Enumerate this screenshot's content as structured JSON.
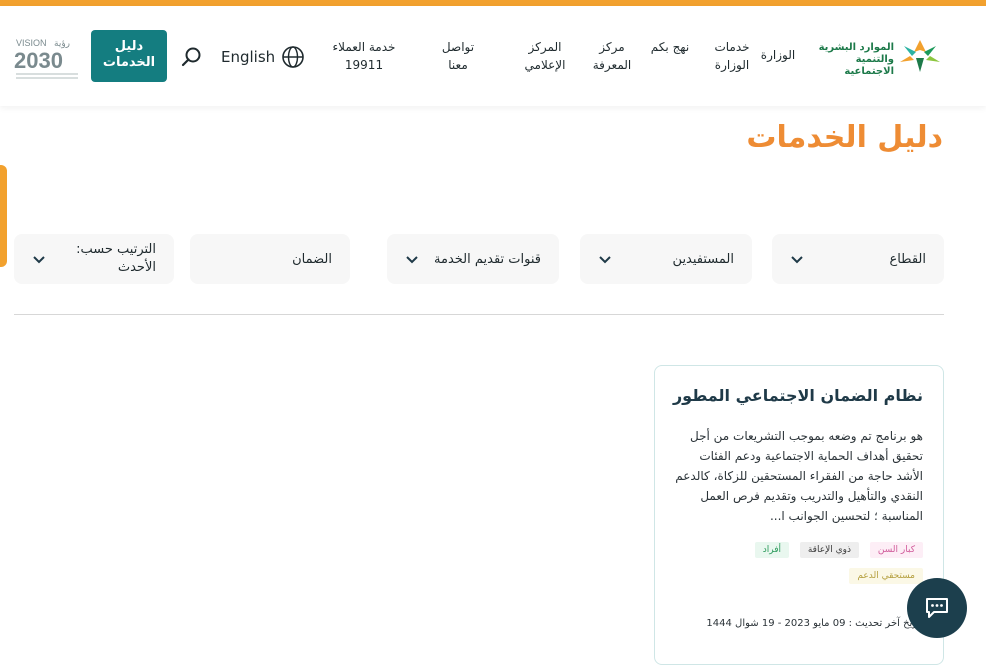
{
  "header": {
    "logo_text": "الموارد البشرية والتنمية الاجتماعية",
    "nav": [
      {
        "label": "الوزارة"
      },
      {
        "label": "خدمات الوزارة"
      },
      {
        "label": "نهج بكم"
      },
      {
        "label": "مركز المعرفة"
      },
      {
        "label": "المركز الإعلامي"
      },
      {
        "label": "تواصل معنا"
      },
      {
        "label": "خدمة العملاء 19911"
      }
    ],
    "language": "English",
    "guide_button": "دليل الخدمات",
    "vision_text": "VISION رؤية 2030"
  },
  "page": {
    "title": "دليل الخدمات"
  },
  "filters": {
    "sector": "القطاع",
    "beneficiaries": "المستفيدين",
    "channels": "قنوات تقديم الخدمة",
    "search_value": "الضمان",
    "sort": "الترتيب حسب: الأحدث"
  },
  "card": {
    "title": "نظام الضمان الاجتماعي المطور",
    "description": "هو برنامج تم وضعه بموجب التشريعات من أجل تحقيق أهداف الحماية الاجتماعية ودعم الفئات الأشد حاجة من الفقراء المستحقين للزكاة، كالدعم النقدي والتأهيل والتدريب وتقديم فرص العمل المناسبة ؛ لتحسين الجوانب ا...",
    "tags": [
      "كبار السن",
      "ذوي الإعاقة",
      "أفراد",
      "مستحقي الدعم"
    ],
    "date": "تاريخ آخر تحديث : 09 مايو 2023 - 19 شوال 1444"
  },
  "colors": {
    "accent": "#f2a12e",
    "title": "#ee8c34",
    "primary": "#147d80",
    "chat": "#1c3f4d"
  }
}
